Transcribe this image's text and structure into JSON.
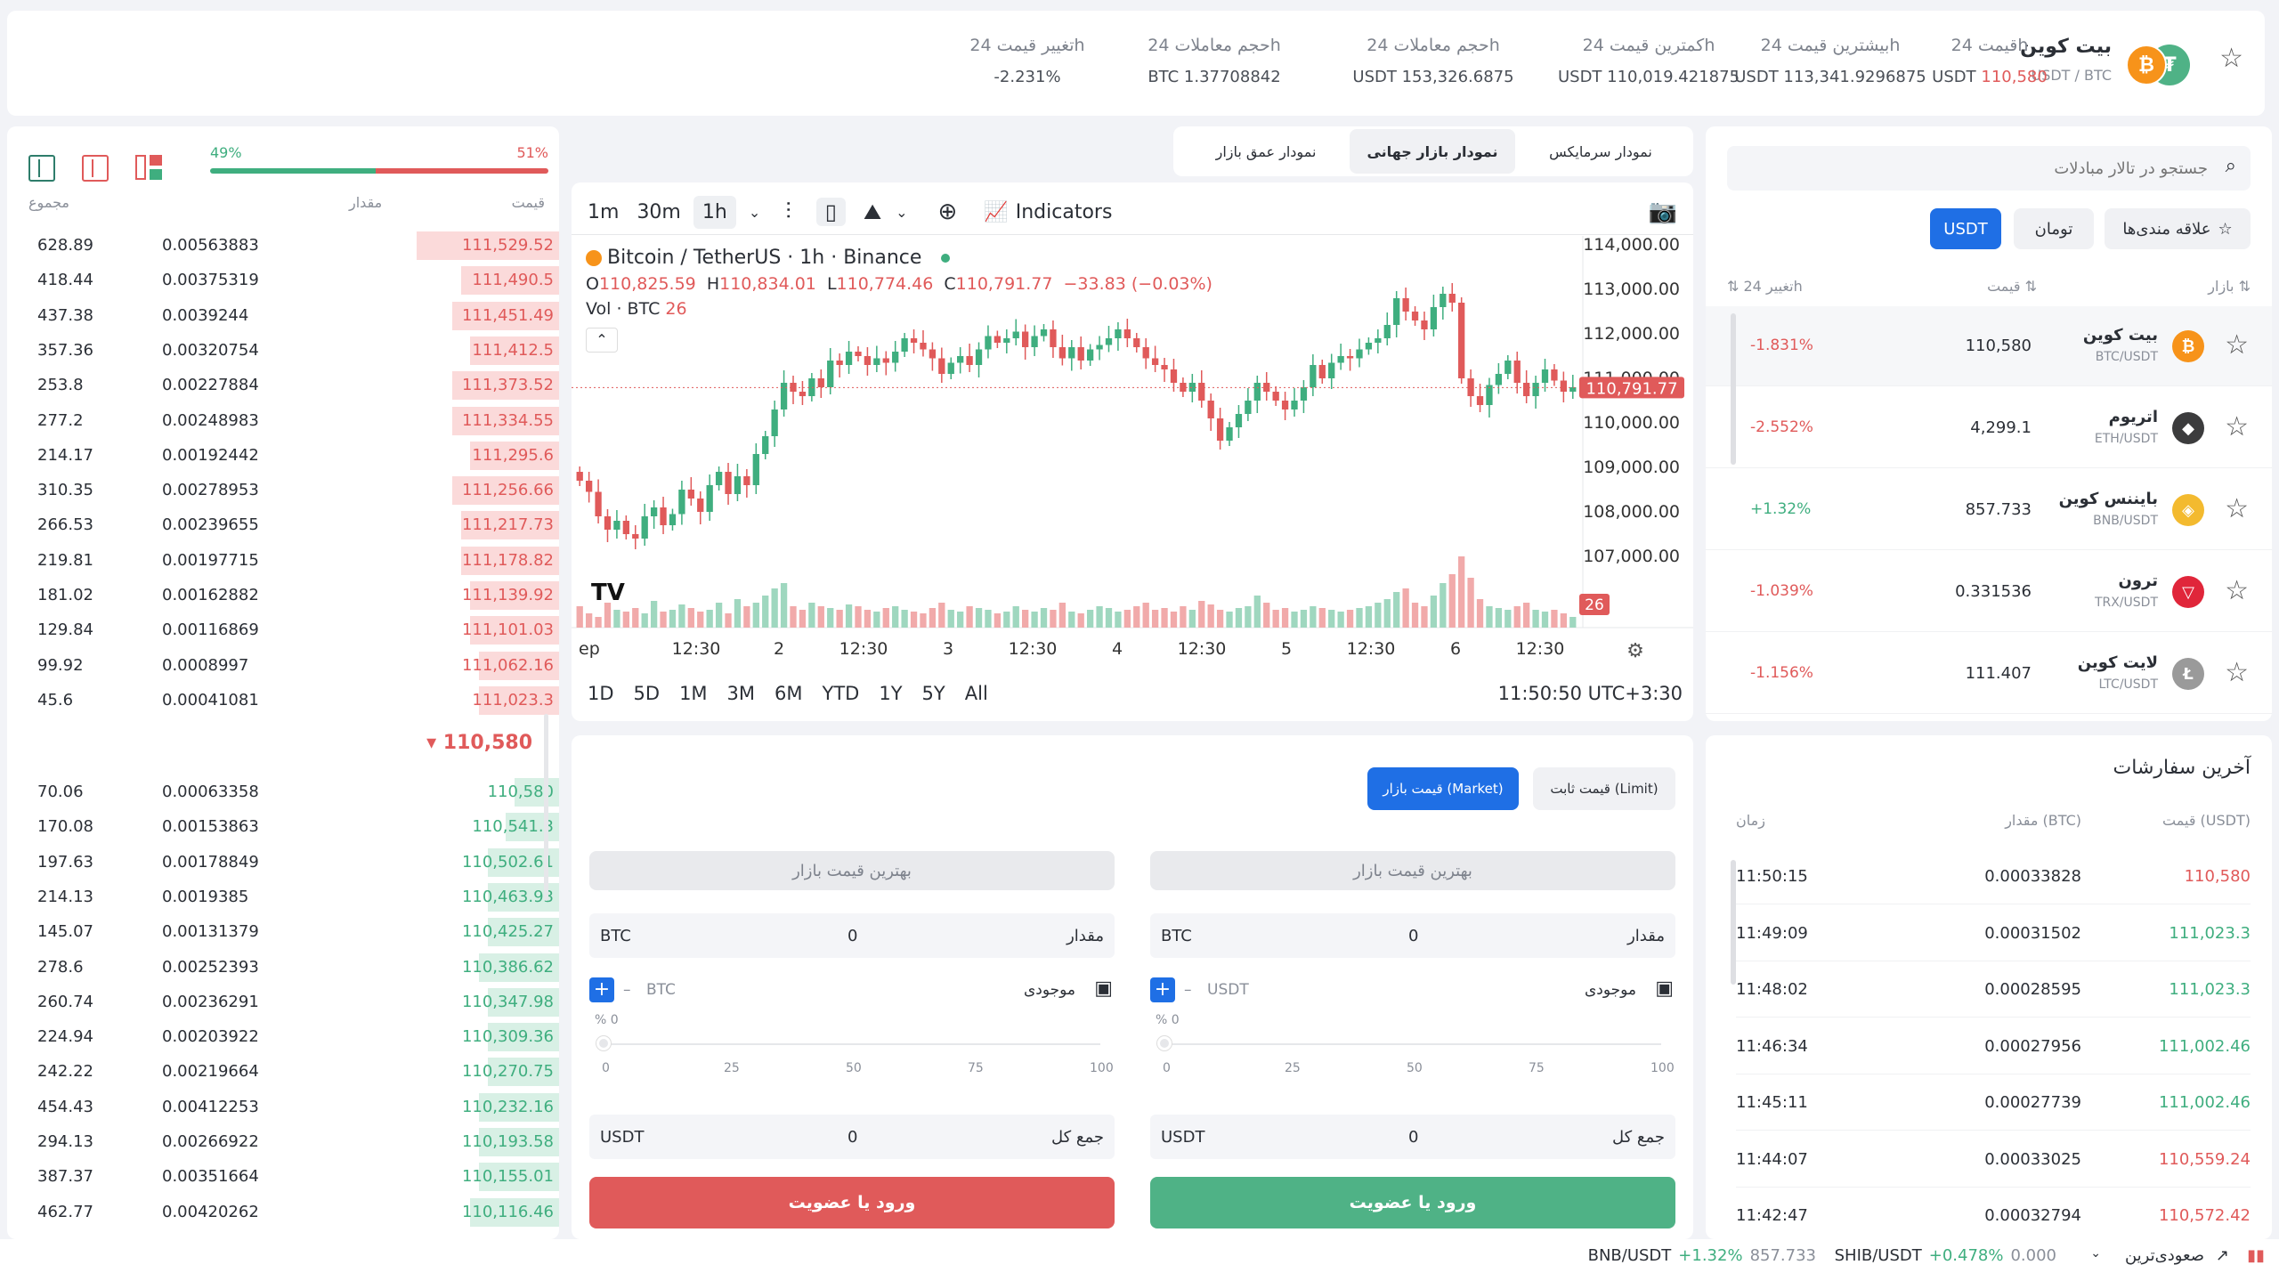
{
  "header": {
    "coin_name": "بیت کوین",
    "pair": "USDT / BTC",
    "stats": [
      {
        "label": "قیمت 24h",
        "value": "USDT 110,580",
        "value_prefix": "USDT",
        "value_num": "110,580"
      },
      {
        "label": "بیشترین قیمت 24h",
        "value": "USDT 113,341.9296875"
      },
      {
        "label": "کمترین قیمت 24h",
        "value": "USDT 110,019.421875"
      },
      {
        "label": "حجم معاملات 24h",
        "value": "USDT 153,326.6875"
      },
      {
        "label": "حجم معاملات 24h",
        "value": "BTC 1.37708842"
      },
      {
        "label": "تغییر قیمت 24h",
        "value": "-2.231%"
      }
    ]
  },
  "orderbook": {
    "buy_pct": "49%",
    "sell_pct": "51%",
    "col_price": "قیمت",
    "col_amount": "مقدار",
    "col_total": "مجموع",
    "asks": [
      {
        "price": "111,529.52",
        "amount": "0.00563883",
        "total": "628.89",
        "depth": 0.8
      },
      {
        "price": "111,490.5",
        "amount": "0.00375319",
        "total": "418.44",
        "depth": 0.55
      },
      {
        "price": "111,451.49",
        "amount": "0.0039244",
        "total": "437.38",
        "depth": 0.6
      },
      {
        "price": "111,412.5",
        "amount": "0.00320754",
        "total": "357.36",
        "depth": 0.5
      },
      {
        "price": "111,373.52",
        "amount": "0.00227884",
        "total": "253.8",
        "depth": 0.6
      },
      {
        "price": "111,334.55",
        "amount": "0.00248983",
        "total": "277.2",
        "depth": 0.6
      },
      {
        "price": "111,295.6",
        "amount": "0.00192442",
        "total": "214.17",
        "depth": 0.5
      },
      {
        "price": "111,256.66",
        "amount": "0.00278953",
        "total": "310.35",
        "depth": 0.6
      },
      {
        "price": "111,217.73",
        "amount": "0.00239655",
        "total": "266.53",
        "depth": 0.55
      },
      {
        "price": "111,178.82",
        "amount": "0.00197715",
        "total": "219.81",
        "depth": 0.55
      },
      {
        "price": "111,139.92",
        "amount": "0.00162882",
        "total": "181.02",
        "depth": 0.5
      },
      {
        "price": "111,101.03",
        "amount": "0.00116869",
        "total": "129.84",
        "depth": 0.5
      },
      {
        "price": "111,062.16",
        "amount": "0.0008997",
        "total": "99.92",
        "depth": 0.45
      },
      {
        "price": "111,023.3",
        "amount": "0.00041081",
        "total": "45.6",
        "depth": 0.45
      }
    ],
    "mid_price": "110,580",
    "bids": [
      {
        "price": "110,580",
        "amount": "0.00063358",
        "total": "70.06",
        "depth": 0.25
      },
      {
        "price": "110,541.3",
        "amount": "0.00153863",
        "total": "170.08",
        "depth": 0.3
      },
      {
        "price": "110,502.61",
        "amount": "0.00178849",
        "total": "197.63",
        "depth": 0.4
      },
      {
        "price": "110,463.93",
        "amount": "0.0019385",
        "total": "214.13",
        "depth": 0.4
      },
      {
        "price": "110,425.27",
        "amount": "0.00131379",
        "total": "145.07",
        "depth": 0.4
      },
      {
        "price": "110,386.62",
        "amount": "0.00252393",
        "total": "278.6",
        "depth": 0.45
      },
      {
        "price": "110,347.98",
        "amount": "0.00236291",
        "total": "260.74",
        "depth": 0.4
      },
      {
        "price": "110,309.36",
        "amount": "0.00203922",
        "total": "224.94",
        "depth": 0.4
      },
      {
        "price": "110,270.75",
        "amount": "0.00219664",
        "total": "242.22",
        "depth": 0.4
      },
      {
        "price": "110,232.16",
        "amount": "0.00412253",
        "total": "454.43",
        "depth": 0.45
      },
      {
        "price": "110,193.58",
        "amount": "0.00266922",
        "total": "294.13",
        "depth": 0.45
      },
      {
        "price": "110,155.01",
        "amount": "0.00351664",
        "total": "387.37",
        "depth": 0.45
      },
      {
        "price": "110,116.46",
        "amount": "0.00420262",
        "total": "462.77",
        "depth": 0.5
      }
    ]
  },
  "chart_tabs": [
    "نمودار سرمایکس",
    "نمودار بازار جهانی",
    "نمودار عمق بازار"
  ],
  "chart_toolbar": {
    "intervals": [
      "1m",
      "30m",
      "1h"
    ],
    "indicators": "Indicators"
  },
  "chart_legend": {
    "title": "Bitcoin / TetherUS · 1h · Binance",
    "o_label": "O",
    "o": "110,825.59",
    "h_label": "H",
    "h": "110,834.01",
    "l_label": "L",
    "l": "110,774.46",
    "c_label": "C",
    "c": "110,791.77",
    "change": "−33.83 (−0.03%)",
    "vol_label": "Vol · BTC",
    "vol": "26"
  },
  "chart_data": {
    "type": "candlestick",
    "title": "Bitcoin / TetherUS · 1h · Binance",
    "y_ticks": [
      "114,000.00",
      "113,000.00",
      "112,000.00",
      "111,000.00",
      "110,000.00",
      "109,000.00",
      "108,000.00",
      "107,000.00"
    ],
    "ylim": [
      106600,
      114200
    ],
    "x_ticks": [
      "ep",
      "12:30",
      "2",
      "12:30",
      "3",
      "12:30",
      "4",
      "12:30",
      "5",
      "12:30",
      "6",
      "12:30"
    ],
    "last_price": "110,791.77",
    "last_volume": "26",
    "close": [
      108700,
      108450,
      107900,
      107600,
      107800,
      107500,
      107400,
      107900,
      108100,
      107700,
      107950,
      108500,
      108300,
      108000,
      108600,
      108900,
      108400,
      108800,
      108600,
      109300,
      109700,
      110300,
      110900,
      110700,
      110600,
      111000,
      110800,
      111400,
      111300,
      111600,
      111500,
      111300,
      111450,
      111350,
      111600,
      111900,
      111800,
      111650,
      111450,
      111100,
      111350,
      111500,
      111300,
      111650,
      111950,
      111800,
      111900,
      112050,
      111700,
      111950,
      112100,
      111700,
      111450,
      111700,
      111400,
      111650,
      111750,
      111900,
      112100,
      111900,
      111700,
      111450,
      111300,
      111200,
      110900,
      110700,
      110900,
      110500,
      110100,
      109600,
      109900,
      110200,
      110500,
      110900,
      110700,
      110500,
      110300,
      110500,
      110800,
      111300,
      111000,
      111350,
      111500,
      111450,
      111650,
      111800,
      111900,
      112200,
      112800,
      112500,
      112300,
      112100,
      112600,
      112900,
      112700,
      111000,
      110600,
      110400,
      110850,
      111100,
      111400,
      110900,
      110600,
      110900,
      111200,
      110950,
      110700,
      110800
    ],
    "volume": [
      12,
      8,
      6,
      14,
      10,
      9,
      11,
      8,
      15,
      9,
      10,
      13,
      11,
      9,
      10,
      14,
      8,
      16,
      12,
      14,
      18,
      22,
      25,
      12,
      10,
      14,
      12,
      11,
      10,
      13,
      12,
      10,
      9,
      11,
      12,
      10,
      9,
      8,
      11,
      14,
      10,
      9,
      12,
      11,
      10,
      8,
      9,
      12,
      10,
      9,
      11,
      10,
      14,
      9,
      8,
      10,
      12,
      11,
      9,
      10,
      12,
      14,
      10,
      11,
      9,
      12,
      10,
      15,
      13,
      10,
      9,
      11,
      12,
      18,
      14,
      10,
      11,
      9,
      10,
      12,
      11,
      10,
      9,
      10,
      11,
      12,
      14,
      16,
      20,
      22,
      14,
      12,
      18,
      25,
      30,
      40,
      28,
      16,
      12,
      11,
      10,
      12,
      14,
      10,
      9,
      10,
      8,
      6
    ]
  },
  "chart_range": [
    "1D",
    "5D",
    "1M",
    "3M",
    "6M",
    "YTD",
    "1Y",
    "5Y",
    "All"
  ],
  "chart_time": "11:50:50 UTC+3:30",
  "market": {
    "search_placeholder": "جستجو در تالار مبادلات",
    "filters": [
      "علاقه مندی‌ها",
      "تومان",
      "USDT"
    ],
    "col_market": "بازار",
    "col_price": "قیمت",
    "col_change": "تغییر 24h",
    "coins": [
      {
        "name": "بیت کوین",
        "pair": "BTC/USDT",
        "price": "110,580",
        "change": "-1.831%",
        "color": "#f7931a",
        "glyph": "₿",
        "icon": "bitcoin-icon"
      },
      {
        "name": "اتریوم",
        "pair": "ETH/USDT",
        "price": "4,299.1",
        "change": "-2.552%",
        "color": "#3c3c3d",
        "glyph": "◆",
        "icon": "ethereum-icon"
      },
      {
        "name": "بایننس کوین",
        "pair": "BNB/USDT",
        "price": "857.733",
        "change": "+1.32%",
        "color": "#f3ba2f",
        "glyph": "◈",
        "icon": "bnb-icon"
      },
      {
        "name": "ترون",
        "pair": "TRX/USDT",
        "price": "0.331536",
        "change": "-1.039%",
        "color": "#e0263a",
        "glyph": "▽",
        "icon": "tron-icon"
      },
      {
        "name": "لایت کوین",
        "pair": "LTC/USDT",
        "price": "111.407",
        "change": "-1.156%",
        "color": "#9a9a9a",
        "glyph": "Ł",
        "icon": "litecoin-icon"
      }
    ]
  },
  "trade": {
    "tab_limit": "قیمت ثابت (Limit)",
    "tab_market": "قیمت بازار (Market)",
    "best_price": "بهترین قیمت بازار",
    "amount_label": "مقدار",
    "amount_value": "0",
    "btc": "BTC",
    "usdt": "USDT",
    "balance_label": "موجودی",
    "balance_value": "–",
    "pct_label": "% 0",
    "slider_ticks": [
      "0",
      "25",
      "50",
      "75",
      "100"
    ],
    "total_label": "جمع کل",
    "total_value": "0",
    "buy_button": "ورود یا عضویت",
    "sell_button": "ورود یا عضویت"
  },
  "recent_trades": {
    "title": "آخرین سفارشات",
    "col_price": "قیمت (USDT)",
    "col_amount": "مقدار (BTC)",
    "col_time": "زمان",
    "rows": [
      {
        "price": "110,580",
        "amount": "0.00033828",
        "time": "11:50:15",
        "side": "sell"
      },
      {
        "price": "111,023.3",
        "amount": "0.00031502",
        "time": "11:49:09",
        "side": "buy"
      },
      {
        "price": "111,023.3",
        "amount": "0.00028595",
        "time": "11:48:02",
        "side": "buy"
      },
      {
        "price": "111,002.46",
        "amount": "0.00027956",
        "time": "11:46:34",
        "side": "buy"
      },
      {
        "price": "111,002.46",
        "amount": "0.00027739",
        "time": "11:45:11",
        "side": "buy"
      },
      {
        "price": "110,559.24",
        "amount": "0.00033025",
        "time": "11:44:07",
        "side": "sell"
      },
      {
        "price": "110,572.42",
        "amount": "0.00032794",
        "time": "11:42:47",
        "side": "sell"
      }
    ]
  },
  "ticker": {
    "label": "صعودی‌ترین",
    "items": [
      {
        "pair": "SHIB/USDT",
        "change": "+0.478%",
        "price": "0.000"
      },
      {
        "pair": "BNB/USDT",
        "change": "+1.32%",
        "price": "857.733"
      }
    ]
  },
  "colors": {
    "red": "#e05a5a",
    "green": "#3fae7f",
    "blue": "#1f6fe5",
    "buy": "#4fb286",
    "sell": "#e05a5a"
  }
}
